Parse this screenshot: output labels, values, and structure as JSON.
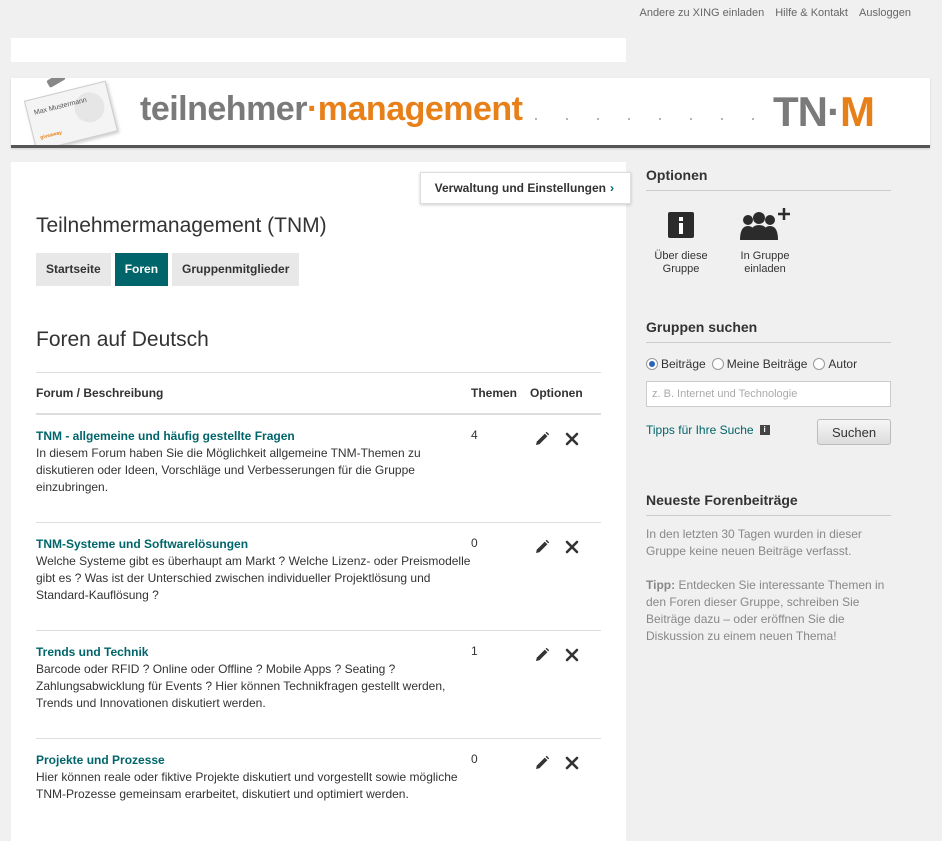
{
  "topnav": {
    "invite": "Andere zu XING einladen",
    "help": "Hilfe & Kontakt",
    "logout": "Ausloggen"
  },
  "banner": {
    "card_name": "Max Mustermann",
    "brand_part1": "teilnehmer",
    "brand_sep": "·",
    "brand_part2": "management",
    "dots": "· · · · · · · · · ·",
    "logo_part1": "TN·",
    "logo_part2": "M",
    "brand_gray": "#7a7a7a",
    "brand_orange": "#e8801a"
  },
  "admin_button": {
    "label": "Verwaltung und Einstellungen",
    "chevron": "›"
  },
  "group": {
    "title": "Teilnehmermanagement (TNM)"
  },
  "tabs": [
    {
      "label": "Startseite",
      "active": false
    },
    {
      "label": "Foren",
      "active": true
    },
    {
      "label": "Gruppenmitglieder",
      "active": false
    }
  ],
  "forums": {
    "section_title": "Foren auf Deutsch",
    "headers": {
      "forum": "Forum / Beschreibung",
      "themen": "Themen",
      "optionen": "Optionen"
    },
    "rows": [
      {
        "title": "TNM - allgemeine und häufig gestellte Fragen",
        "desc": "In diesem Forum haben Sie die Möglichkeit allgemeine TNM-Themen zu diskutieren oder Ideen, Vorschläge und Verbesserungen für die Gruppe einzubringen.",
        "count": "4"
      },
      {
        "title": "TNM-Systeme und Softwarelösungen",
        "desc": "Welche Systeme gibt es überhaupt am Markt ? Welche Lizenz- oder Preismodelle gibt es ? Was ist der Unterschied zwischen individueller Projektlösung und Standard-Kauflösung ?",
        "count": "0"
      },
      {
        "title": "Trends und Technik",
        "desc": "Barcode oder RFID ? Online oder Offline ? Mobile Apps ? Seating ? Zahlungsabwicklung für Events ? Hier können Technikfragen gestellt werden, Trends und Innovationen diskutiert werden.",
        "count": "1"
      },
      {
        "title": "Projekte und Prozesse",
        "desc": "Hier können reale oder fiktive Projekte diskutiert und vorgestellt sowie mögliche TNM-Prozesse gemeinsam erarbeitet, diskutiert und optimiert werden.",
        "count": "0"
      }
    ]
  },
  "sidebar": {
    "options_title": "Optionen",
    "about_label": "Über diese Gruppe",
    "invite_label": "In Gruppe einladen",
    "search_title": "Gruppen suchen",
    "radio_posts": "Beiträge",
    "radio_my_posts": "Meine Beiträge",
    "radio_author": "Autor",
    "search_placeholder": "z. B. Internet und Technologie",
    "tips_label": "Tipps für Ihre Suche",
    "search_button": "Suchen",
    "latest_title": "Neueste Forenbeiträge",
    "latest_text": "In den letzten 30 Tagen wurden in dieser Gruppe keine neuen Beiträge verfasst.",
    "tip_label": "Tipp:",
    "tip_text": " Entdecken Sie interessante Themen in den Foren dieser Gruppe, schreiben Sie Beiträge dazu – oder eröffnen Sie die Diskussion zu einem neuen Thema!"
  },
  "colors": {
    "accent": "#00656a"
  }
}
